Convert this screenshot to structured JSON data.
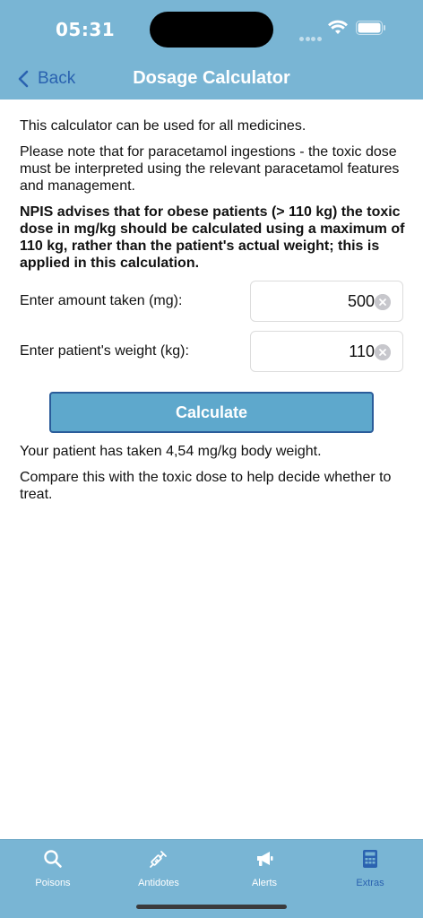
{
  "status_bar": {
    "time": "05:31"
  },
  "nav": {
    "back_label": "Back",
    "title": "Dosage Calculator",
    "back_icon": "chevron-left-icon"
  },
  "intro": {
    "para1": "This calculator can be used for all medicines.",
    "para2": "Please note that for paracetamol ingestions - the toxic dose must be interpreted using the relevant paracetamol features and management.",
    "para3": "NPIS advises that for obese patients (> 110 kg) the toxic dose in mg/kg should be calculated using a maximum of 110 kg, rather than the patient's actual weight; this is applied in this calculation."
  },
  "form": {
    "amount_label": "Enter amount taken (mg):",
    "amount_value": "500",
    "weight_label": "Enter patient's weight (kg):",
    "weight_value": "110",
    "calculate_label": "Calculate"
  },
  "result": {
    "text": "Your patient has taken 4,54 mg/kg body weight.",
    "advice": "Compare this with the toxic dose to help decide whether to treat."
  },
  "tabs": [
    {
      "label": "Poisons",
      "icon": "search-icon",
      "active": false
    },
    {
      "label": "Antidotes",
      "icon": "syringe-icon",
      "active": false
    },
    {
      "label": "Alerts",
      "icon": "megaphone-icon",
      "active": false
    },
    {
      "label": "Extras",
      "icon": "calculator-icon",
      "active": true
    }
  ],
  "colors": {
    "header_bg": "#79b5d4",
    "accent": "#2a62b0",
    "button_bg": "#5ea8cc",
    "button_border": "#2a5c9a"
  }
}
